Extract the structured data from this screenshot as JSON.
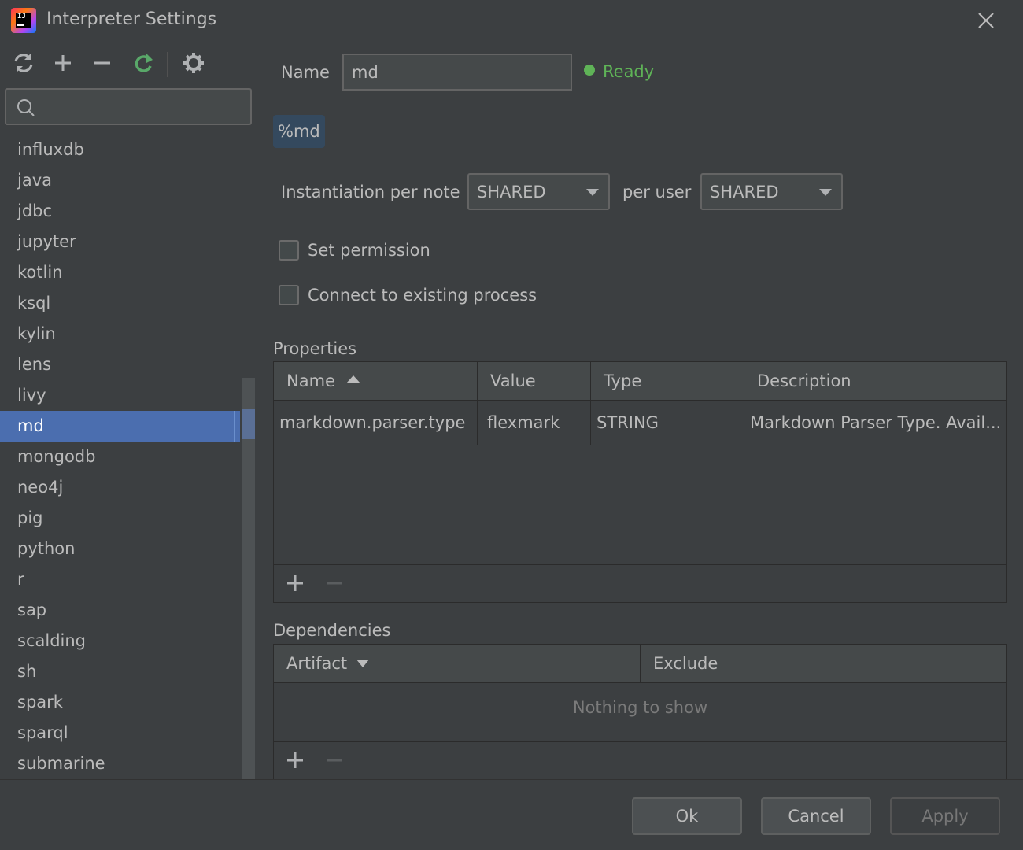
{
  "window": {
    "title": "Interpreter Settings"
  },
  "icons": {
    "accent_green": "#5fb357",
    "selection": "#4b6eaf"
  },
  "toolbar": {
    "buttons": [
      "refresh-icon",
      "add-icon",
      "remove-icon",
      "restart-icon",
      "settings-icon"
    ]
  },
  "search": {
    "placeholder": "",
    "value": ""
  },
  "interpreters": {
    "items": [
      "influxdb",
      "java",
      "jdbc",
      "jupyter",
      "kotlin",
      "ksql",
      "kylin",
      "lens",
      "livy",
      "md",
      "mongodb",
      "neo4j",
      "pig",
      "python",
      "r",
      "sap",
      "scalding",
      "sh",
      "spark",
      "sparql",
      "submarine"
    ],
    "selected": "md"
  },
  "form": {
    "name_label": "Name",
    "name_value": "md",
    "status": "Ready",
    "tag": "%md",
    "instantiation_label": "Instantiation per note",
    "instantiation_value": "SHARED",
    "per_user_label": "per user",
    "per_user_value": "SHARED",
    "set_permission_label": "Set permission",
    "set_permission_checked": false,
    "connect_label": "Connect to existing process",
    "connect_checked": false
  },
  "properties": {
    "title": "Properties",
    "columns": [
      "Name",
      "Value",
      "Type",
      "Description"
    ],
    "rows": [
      {
        "name": "markdown.parser.type",
        "value": "flexmark",
        "type": "STRING",
        "description": "Markdown Parser Type. Avail..."
      }
    ]
  },
  "dependencies": {
    "title": "Dependencies",
    "columns": [
      "Artifact",
      "Exclude"
    ],
    "empty_text": "Nothing to show"
  },
  "buttons": {
    "ok": "Ok",
    "cancel": "Cancel",
    "apply": "Apply"
  }
}
